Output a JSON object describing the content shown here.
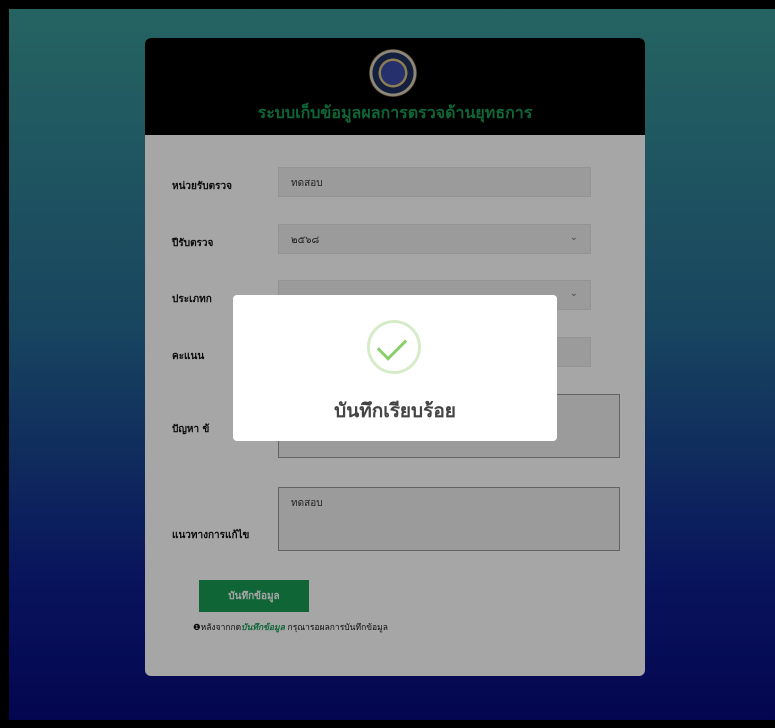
{
  "header": {
    "logo": "seal-logo",
    "title": "ระบบเก็บข้อมูลผลการตรวจด้านยุทธการ"
  },
  "form": {
    "unit": {
      "label": "หน่วยรับตรวจ",
      "value": "ทดสอบ"
    },
    "year": {
      "label": "ปีรับตรวจ",
      "value": "๒๕๖๘"
    },
    "type": {
      "label": "ประเภทก",
      "value": ""
    },
    "score": {
      "label": "คะแนน",
      "value": ""
    },
    "problem": {
      "label": "ปัญหา ข้",
      "value": ""
    },
    "solution": {
      "label": "แนวทางการแก้ไข",
      "value": "ทดสอบ"
    },
    "submit_label": "บันทึกข้อมูล",
    "note_icon": "info-icon",
    "note_prefix": "หลังจากกด",
    "note_emph": "บันทึกข้อมูล",
    "note_suffix": " กรุณารอผลการบันทึกข้อมูล"
  },
  "modal": {
    "icon": "success-check-icon",
    "title": "บันทึกเรียบร้อย"
  },
  "colors": {
    "accent": "#1a9c55",
    "success": "#8bcf6b"
  }
}
